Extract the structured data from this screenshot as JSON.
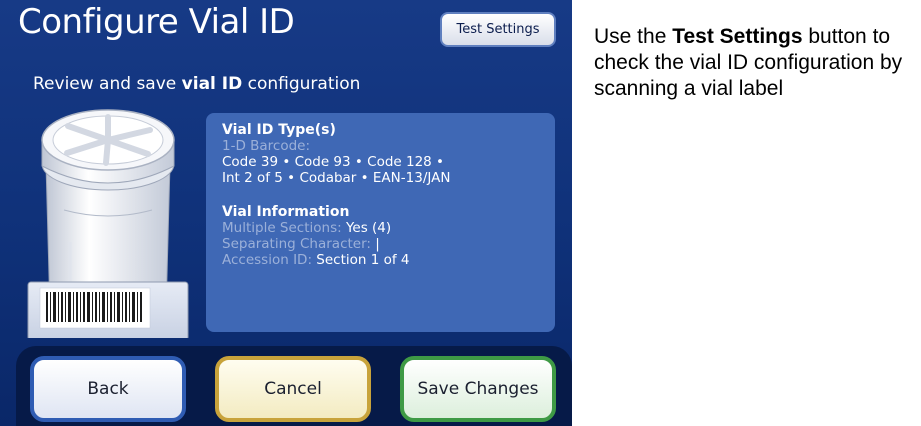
{
  "screen": {
    "title": "Configure Vial ID",
    "test_settings_label": "Test Settings",
    "subtitle": {
      "prefix": "Review and save ",
      "emphasis": "vial ID",
      "suffix": " configuration"
    }
  },
  "summary": {
    "vial_id_type": {
      "heading": "Vial ID Type(s)",
      "barcode_label": "1-D Barcode:",
      "barcode_line1": "Code 39 • Code 93 • Code 128 •",
      "barcode_line2": "Int 2 of 5 • Codabar • EAN-13/JAN"
    },
    "vial_info": {
      "heading": "Vial Information",
      "rows": [
        {
          "label": "Multiple Sections:",
          "value": "Yes (4)"
        },
        {
          "label": "Separating Character:",
          "value": "|"
        },
        {
          "label": "Accession ID:",
          "value": "Section 1 of 4"
        }
      ]
    }
  },
  "buttons": {
    "back": "Back",
    "cancel": "Cancel",
    "save": "Save Changes"
  },
  "callout": {
    "prefix": "Use the ",
    "emphasis": "Test Settings",
    "suffix": " button to check the vial ID configuration by scanning a vial label"
  },
  "colors": {
    "screen_bg": "#0f3179",
    "panel_bg": "#3f68b5",
    "back_border": "#2f5cb3",
    "cancel_border": "#c8a33b",
    "save_border": "#3e9a45"
  }
}
